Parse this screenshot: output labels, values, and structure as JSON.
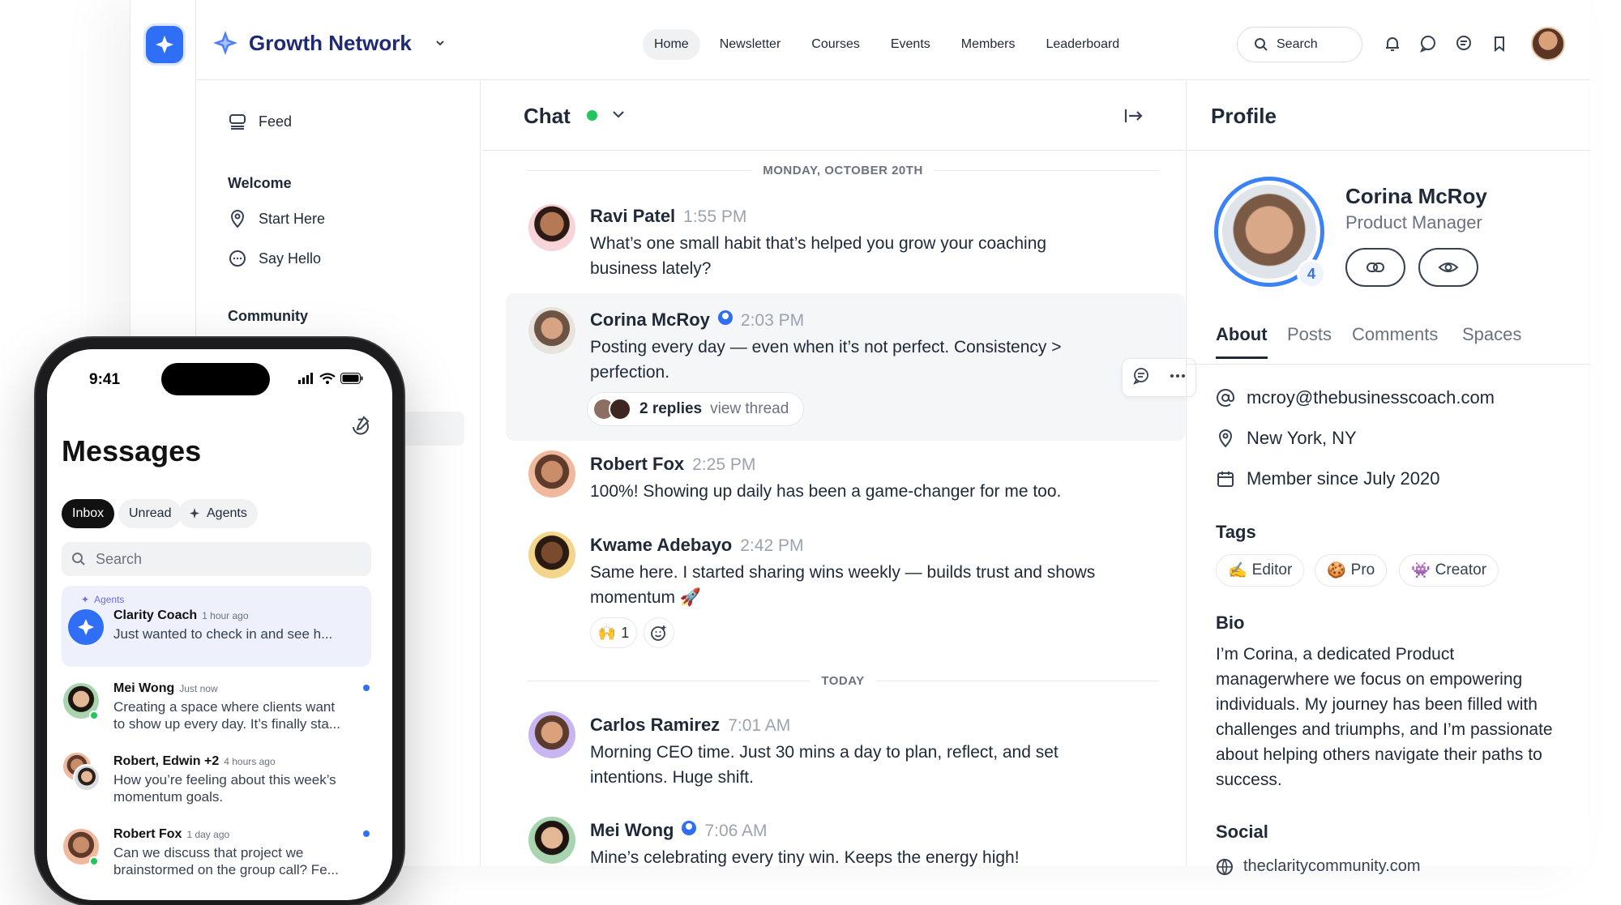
{
  "app": {
    "brand": "Growth Network",
    "nav": [
      "Home",
      "Newsletter",
      "Courses",
      "Events",
      "Members",
      "Leaderboard"
    ],
    "search_placeholder": "Search",
    "accent": "#2f6ff5"
  },
  "sidebar": {
    "feed": "Feed",
    "welcome_heading": "Welcome",
    "welcome_items": [
      "Start Here",
      "Say Hello"
    ],
    "community_heading": "Community"
  },
  "chat": {
    "title": "Chat",
    "date_divider": "MONDAY, OCTOBER 20TH",
    "today_divider": "TODAY",
    "messages": [
      {
        "name": "Ravi Patel",
        "time": "1:55 PM",
        "text": "What’s one small habit that’s helped you grow your coaching\nbusiness lately?"
      },
      {
        "name": "Corina McRoy",
        "time": "2:03 PM",
        "text": "Posting every day — even when it’s not perfect. Consistency >\nperfection.",
        "replies": "2 replies",
        "view_thread": "view thread"
      },
      {
        "name": "Robert Fox",
        "time": "2:25 PM",
        "text": "100%! Showing up daily has been a game-changer for me too."
      },
      {
        "name": "Kwame Adebayo",
        "time": "2:42 PM",
        "text": "Same here. I started sharing wins weekly — builds trust and shows\nmomentum 🚀",
        "reaction_emoji": "🙌",
        "reaction_count": "1"
      },
      {
        "name": "Carlos Ramirez",
        "time": "7:01 AM",
        "text": "Morning CEO time. Just 30 mins a day to plan, reflect, and set\nintentions. Huge shift."
      },
      {
        "name": "Mei Wong",
        "time": "7:06 AM",
        "text": "Mine’s celebrating every tiny win. Keeps the energy high!"
      }
    ]
  },
  "profile": {
    "title": "Profile",
    "name": "Corina McRoy",
    "role": "Product Manager",
    "level": "4",
    "tabs": [
      "About",
      "Posts",
      "Comments",
      "Spaces"
    ],
    "email": "mcroy@thebusinesscoach.com",
    "location": "New York, NY",
    "member_since": "Member since July 2020",
    "tags_heading": "Tags",
    "tags": [
      {
        "emoji": "✍️",
        "label": "Editor"
      },
      {
        "emoji": "🍪",
        "label": "Pro"
      },
      {
        "emoji": "👾",
        "label": "Creator"
      }
    ],
    "bio_heading": "Bio",
    "bio": "I’m Corina, a dedicated Product managerwhere we focus on empowering individuals. My journey has been filled with challenges and triumphs, and I’m passionate about helping others navigate their paths to success.",
    "social_heading": "Social",
    "social_link": "theclaritycommunity.com"
  },
  "phone": {
    "time": "9:41",
    "title": "Messages",
    "chips": [
      "Inbox",
      "Unread",
      "Agents"
    ],
    "search_placeholder": "Search",
    "threads": [
      {
        "tag": "Agents",
        "name": "Clarity Coach",
        "ago": "1 hour ago",
        "preview": "Just wanted to check in and see h..."
      },
      {
        "name": "Mei Wong",
        "ago": "Just now",
        "preview": "Creating a space where clients want\nto show up every day. It’s finally sta..."
      },
      {
        "name": "Robert, Edwin +2",
        "ago": "4 hours ago",
        "preview": "How you’re feeling about this week’s\nmomentum goals."
      },
      {
        "name": "Robert Fox",
        "ago": "1 day ago",
        "preview": "Can we discuss that project we\nbrainstormed on the group call? Fe..."
      }
    ]
  }
}
